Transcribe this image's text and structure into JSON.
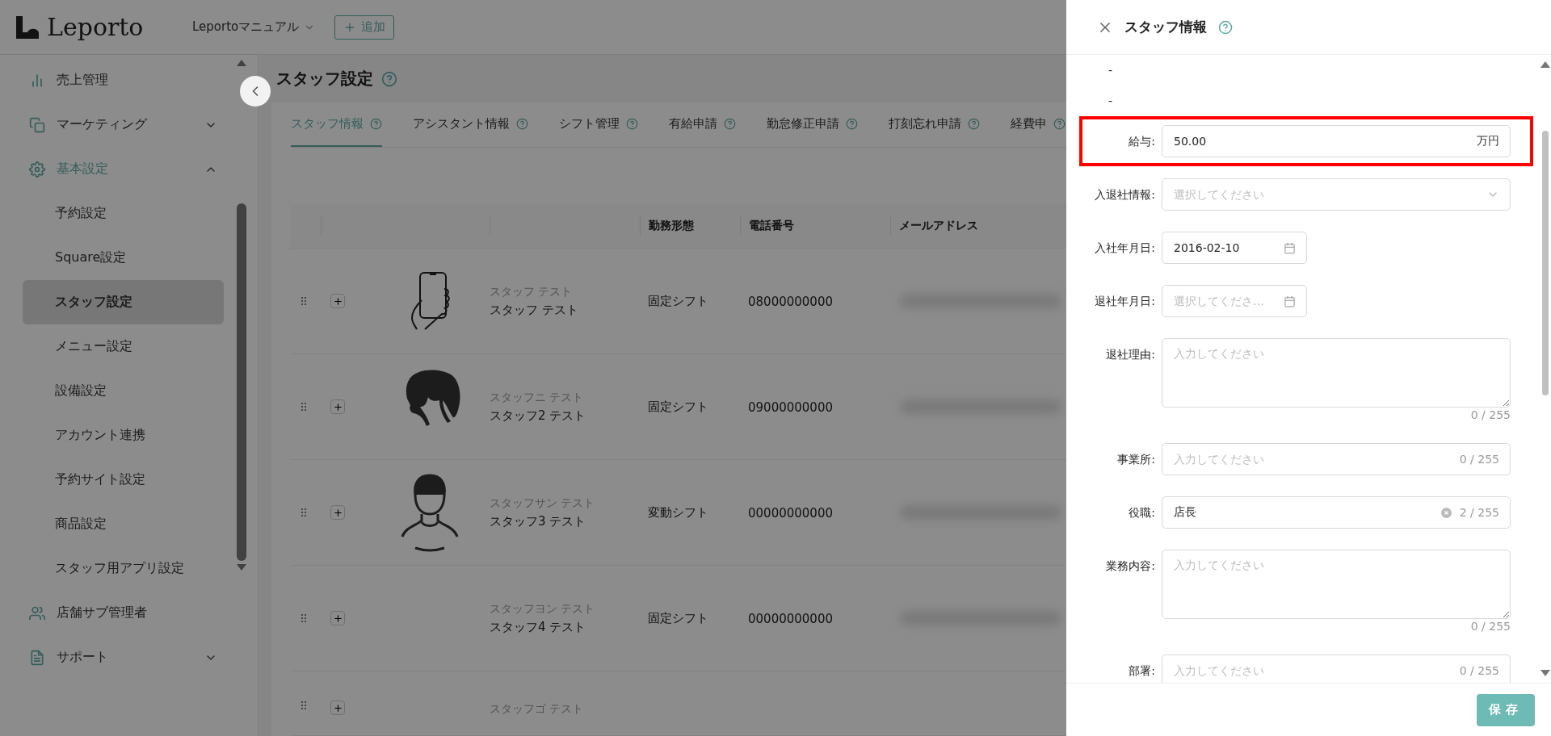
{
  "header": {
    "logo": "Leporto",
    "store_select": "Leportoマニュアル",
    "add_button": "追加"
  },
  "sidebar": {
    "items": [
      {
        "label": "売上管理",
        "selected": false
      },
      {
        "label": "マーケティング",
        "selected": false,
        "expanded": false
      },
      {
        "label": "基本設定",
        "selected": true,
        "expanded": true,
        "children": [
          {
            "label": "予約設定",
            "selected": false
          },
          {
            "label": "Square設定",
            "selected": false
          },
          {
            "label": "スタッフ設定",
            "selected": true
          },
          {
            "label": "メニュー設定",
            "selected": false
          },
          {
            "label": "設備設定",
            "selected": false
          },
          {
            "label": "アカウント連携",
            "selected": false
          },
          {
            "label": "予約サイト設定",
            "selected": false
          },
          {
            "label": "商品設定",
            "selected": false
          },
          {
            "label": "スタッフ用アプリ設定",
            "selected": false
          }
        ]
      },
      {
        "label": "店舗サブ管理者",
        "selected": false
      },
      {
        "label": "サポート",
        "selected": false,
        "expanded": false
      }
    ]
  },
  "page": {
    "title": "スタッフ設定",
    "tabs": [
      {
        "label": "スタッフ情報",
        "selected": true
      },
      {
        "label": "アシスタント情報",
        "selected": false
      },
      {
        "label": "シフト管理",
        "selected": false
      },
      {
        "label": "有給申請",
        "selected": false
      },
      {
        "label": "勤怠修正申請",
        "selected": false
      },
      {
        "label": "打刻忘れ申請",
        "selected": false
      },
      {
        "label": "経費申",
        "selected": false
      }
    ],
    "table": {
      "columns": [
        "勤務形態",
        "電話番号",
        "メールアドレス"
      ],
      "rows": [
        {
          "avatar": {
            "kind": "phone"
          },
          "kana": "スタッフ テスト",
          "name": "スタッフ テスト",
          "work_type": "固定シフト",
          "phone": "08000000000"
        },
        {
          "avatar": {
            "kind": "woman"
          },
          "kana": "スタッフニ テスト",
          "name": "スタッフ2 テスト",
          "work_type": "固定シフト",
          "phone": "09000000000"
        },
        {
          "avatar": {
            "kind": "man"
          },
          "kana": "スタッフサン テスト",
          "name": "スタッフ3 テスト",
          "work_type": "変動シフト",
          "phone": "00000000000"
        },
        {
          "avatar": {
            "kind": "none"
          },
          "kana": "スタッフヨン テスト",
          "name": "スタッフ4 テスト",
          "work_type": "固定シフト",
          "phone": "00000000000"
        },
        {
          "avatar": {
            "kind": "none"
          },
          "kana": "スタッフゴ テスト"
        }
      ]
    }
  },
  "drawer": {
    "title": "スタッフ情報",
    "lines": [
      "-",
      "-"
    ],
    "fields": [
      {
        "kind": "number",
        "label": "給与:",
        "value": "50.00",
        "suffix": "万円",
        "highlighted": true
      },
      {
        "kind": "select",
        "label": "入退社情報:",
        "placeholder": "選択してください",
        "highlighted": false
      },
      {
        "kind": "date",
        "label": "入社年月日:",
        "value": "2016-02-10",
        "highlighted": false
      },
      {
        "kind": "date",
        "label": "退社年月日:",
        "placeholder": "選択してくださ…",
        "highlighted": false
      },
      {
        "kind": "textarea",
        "label": "退社理由:",
        "placeholder": "入力してください",
        "counter": "0 / 255",
        "highlighted": false
      },
      {
        "kind": "text",
        "label": "事業所:",
        "placeholder": "入力してください",
        "counter": "0 / 255",
        "highlighted": false
      },
      {
        "kind": "text",
        "label": "役職:",
        "value": "店長",
        "clearable": true,
        "counter": "2 / 255",
        "highlighted": false
      },
      {
        "kind": "textarea",
        "label": "業務内容:",
        "placeholder": "入力してください",
        "counter": "0 / 255",
        "highlighted": false
      },
      {
        "kind": "text",
        "label": "部署:",
        "placeholder": "入力してください",
        "counter": "0 / 255",
        "highlighted": false
      }
    ],
    "save_button": "保存"
  }
}
